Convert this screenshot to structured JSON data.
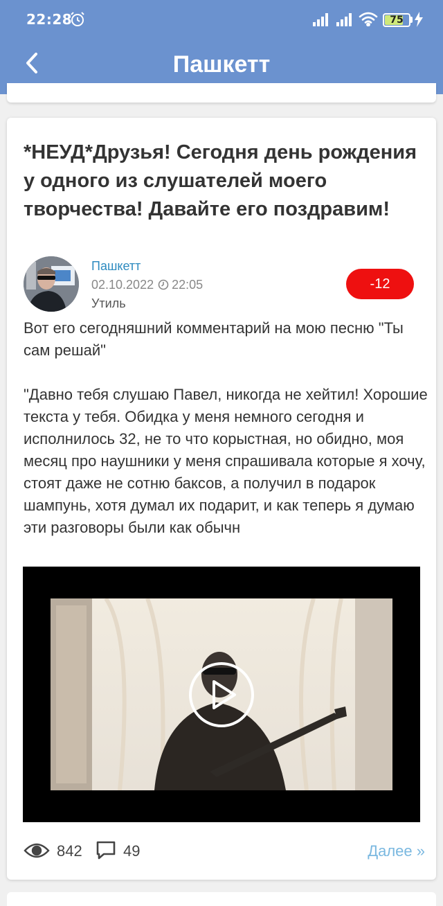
{
  "status_bar": {
    "time": "22:28",
    "battery": "75",
    "battery_level": 0.75
  },
  "header": {
    "title": "Пашкетт"
  },
  "post": {
    "title": "*НЕУД*Друзья! Сегодня день рождения у одного из слушателей моего творчества! Давайте его поздравим!",
    "author": "Пашкетт",
    "date": "02.10.2022",
    "time": "22:05",
    "category": "Утиль",
    "rating": "-12",
    "text": "Вот его сегодняшний комментарий на мою песню \"Ты сам решай\"\n\n\"Давно тебя слушаю Павел, никогда не хейтил! Хорошие текста у тебя. Обидка у меня немного сегодня и исполнилось 32, не то что корыстная, но обидно, моя месяц про наушники у меня спрашивала которые я хочу, стоят даже не сотню баксов, а получил в подарок шампунь, хотя думал их подарит, и как теперь я думаю эти разговоры были как обычн",
    "views": "842",
    "comments": "49",
    "more_label": "Далее »"
  },
  "colors": {
    "header": "#6b92cf",
    "rating_badge": "#ee1010",
    "author_link": "#2e8bc0",
    "more_link": "#7ab8e0"
  },
  "icons": [
    "alarm-icon",
    "cellular-signal-icon",
    "wifi-icon",
    "battery-icon",
    "charging-bolt-icon",
    "back-arrow-icon",
    "clock-icon",
    "play-icon",
    "eye-icon",
    "comment-icon"
  ]
}
